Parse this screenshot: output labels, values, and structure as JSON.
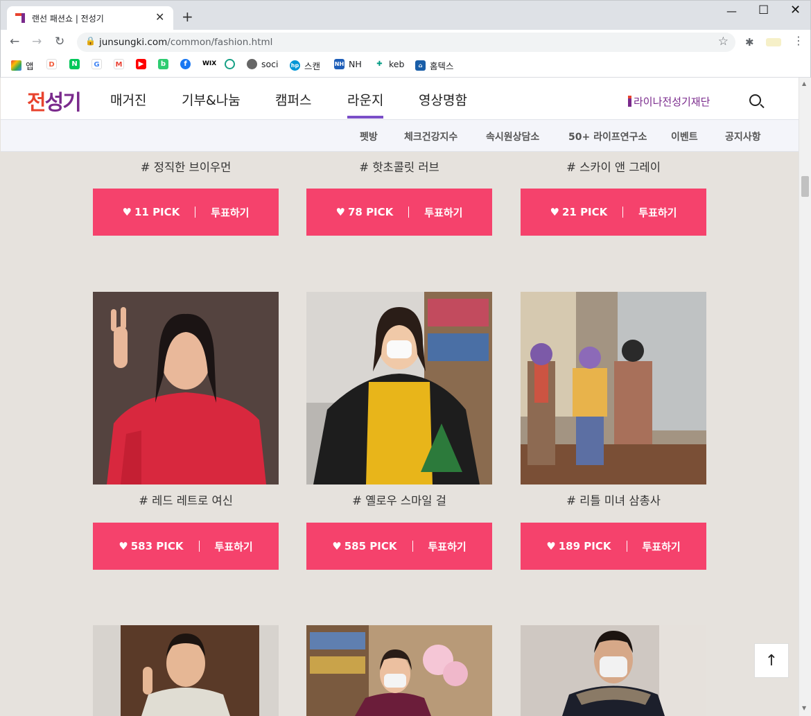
{
  "browser": {
    "tab_title": "랜선 패션쇼 | 전성기",
    "url_domain": "junsungki.com",
    "url_path": "/common/fashion.html",
    "bookmarks": [
      {
        "label": "앱",
        "icon": "apps-grid-icon"
      },
      {
        "label": "",
        "icon": "daum-icon"
      },
      {
        "label": "",
        "icon": "naver-icon"
      },
      {
        "label": "",
        "icon": "google-icon"
      },
      {
        "label": "",
        "icon": "gmail-icon"
      },
      {
        "label": "",
        "icon": "youtube-icon"
      },
      {
        "label": "",
        "icon": "green-app-icon"
      },
      {
        "label": "",
        "icon": "facebook-icon"
      },
      {
        "label": "",
        "icon": "wix-icon"
      },
      {
        "label": "",
        "icon": "target-icon"
      },
      {
        "label": "soci",
        "icon": "globe-icon"
      },
      {
        "label": "스캔",
        "icon": "hp-icon"
      },
      {
        "label": "NH",
        "icon": "nh-icon"
      },
      {
        "label": "keb",
        "icon": "keb-icon"
      },
      {
        "label": "홈텍스",
        "icon": "hometax-icon"
      }
    ]
  },
  "header": {
    "logo": {
      "part1": "전",
      "part2": "성기"
    },
    "nav": [
      "매거진",
      "기부&나눔",
      "캠퍼스",
      "라운지",
      "영상명함"
    ],
    "active_nav": "라운지",
    "foundation": "라이나전성기재단"
  },
  "subnav": [
    "펫방",
    "체크건강지수",
    "속시원상담소",
    "50+ 라이프연구소",
    "이벤트",
    "공지사항"
  ],
  "entries": [
    {
      "caption": "# 정직한 브이우먼",
      "picks": "11 PICK",
      "vote": "투표하기"
    },
    {
      "caption": "# 핫초콜릿 러브",
      "picks": "78 PICK",
      "vote": "투표하기"
    },
    {
      "caption": "# 스카이 앤 그레이",
      "picks": "21 PICK",
      "vote": "투표하기"
    },
    {
      "caption": "# 레드 레트로 여신",
      "picks": "583 PICK",
      "vote": "투표하기"
    },
    {
      "caption": "# 옐로우 스마일 걸",
      "picks": "585 PICK",
      "vote": "투표하기"
    },
    {
      "caption": "# 리틀 미녀 삼총사",
      "picks": "189 PICK",
      "vote": "투표하기"
    }
  ],
  "colors": {
    "accent": "#f5426c",
    "brand": "#7a2a8c",
    "background": "#e6e2dd"
  }
}
